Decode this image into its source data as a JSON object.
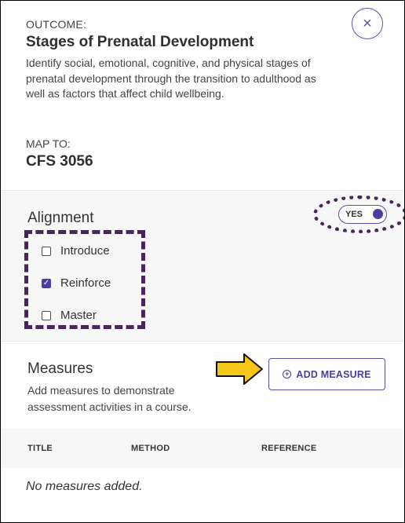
{
  "outcome": {
    "label": "OUTCOME:",
    "title": "Stages of Prenatal Development",
    "description": "Identify social, emotional, cognitive, and physical stages of prenatal development through the transition to adulthood as well as factors that affect child wellbeing.",
    "close_icon": "close-icon"
  },
  "map_to": {
    "label": "MAP TO:",
    "value": "CFS 3056"
  },
  "alignment": {
    "title": "Alignment",
    "toggle_label": "YES",
    "toggle_on": true,
    "options": [
      {
        "label": "Introduce",
        "checked": false
      },
      {
        "label": "Reinforce",
        "checked": true
      },
      {
        "label": "Master",
        "checked": false
      }
    ],
    "annotation_color": "#4a245e"
  },
  "measures": {
    "title": "Measures",
    "description": "Add measures to demonstrate assessment activities in a course.",
    "add_button_label": "ADD MEASURE",
    "add_icon": "plus-circle-icon",
    "arrow_color": "#f5c518",
    "table": {
      "columns": [
        "TITLE",
        "METHOD",
        "REFERENCE"
      ],
      "empty_text": "No measures added."
    }
  },
  "colors": {
    "accent": "#4a3f9e"
  }
}
